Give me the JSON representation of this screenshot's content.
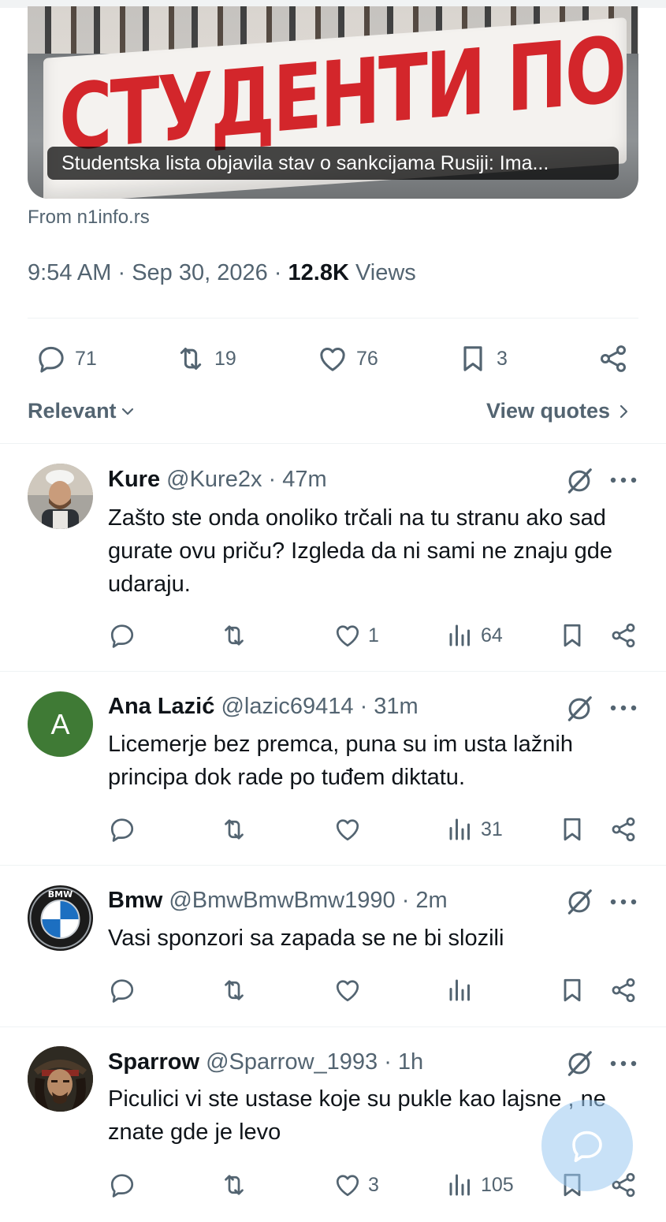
{
  "media": {
    "banner_text": "СТУДЕНТИ ПОБЕЂУЈУ!",
    "caption": "Studentska lista objavila stav o sankcijama Rusiji: Ima..."
  },
  "source": "From n1info.rs",
  "meta": {
    "time": "9:54 AM",
    "date": "Sep 30, 2026",
    "views_count": "12.8K",
    "views_label": "Views"
  },
  "stats": {
    "replies": "71",
    "reposts": "19",
    "likes": "76",
    "bookmarks": "3"
  },
  "sort": {
    "label": "Relevant",
    "view_quotes": "View quotes"
  },
  "replies": [
    {
      "name": "Kure",
      "handle": "@Kure2x · 47m",
      "text": "Zašto ste onda onoliko trčali na tu stranu ako sad gurate ovu priču? Izgleda da ni sami ne znaju gde udaraju.",
      "likes": "1",
      "views": "64"
    },
    {
      "name": "Ana Lazić",
      "handle": "@lazic69414 · 31m",
      "avatar_letter": "A",
      "text": "Licemerje bez premca, puna su im usta lažnih principa dok rade po tuđem diktatu.",
      "likes": "",
      "views": "31"
    },
    {
      "name": "Bmw",
      "handle": "@BmwBmwBmw1990 · 2m",
      "avatar_letters": "BMW",
      "text": "Vasi sponzori sa zapada se ne bi slozili",
      "likes": "",
      "views": ""
    },
    {
      "name": "Sparrow",
      "handle": "@Sparrow_1993 · 1h",
      "text": "Piculici vi ste ustase koje su pukle kao lajsne , ne znate gde je levo",
      "likes": "3",
      "views": "105"
    }
  ],
  "colors": {
    "text": "#0f1419",
    "secondary": "#536471",
    "divider": "#eff3f4",
    "ana_avatar": "#3f7a35",
    "fab": "#9bc8f0"
  },
  "icons": [
    "reply-icon",
    "repost-icon",
    "like-icon",
    "bookmark-icon",
    "share-icon",
    "views-icon",
    "grok-icon",
    "more-icon",
    "chevron-down-icon",
    "chevron-right-icon",
    "compose-reply-icon"
  ]
}
